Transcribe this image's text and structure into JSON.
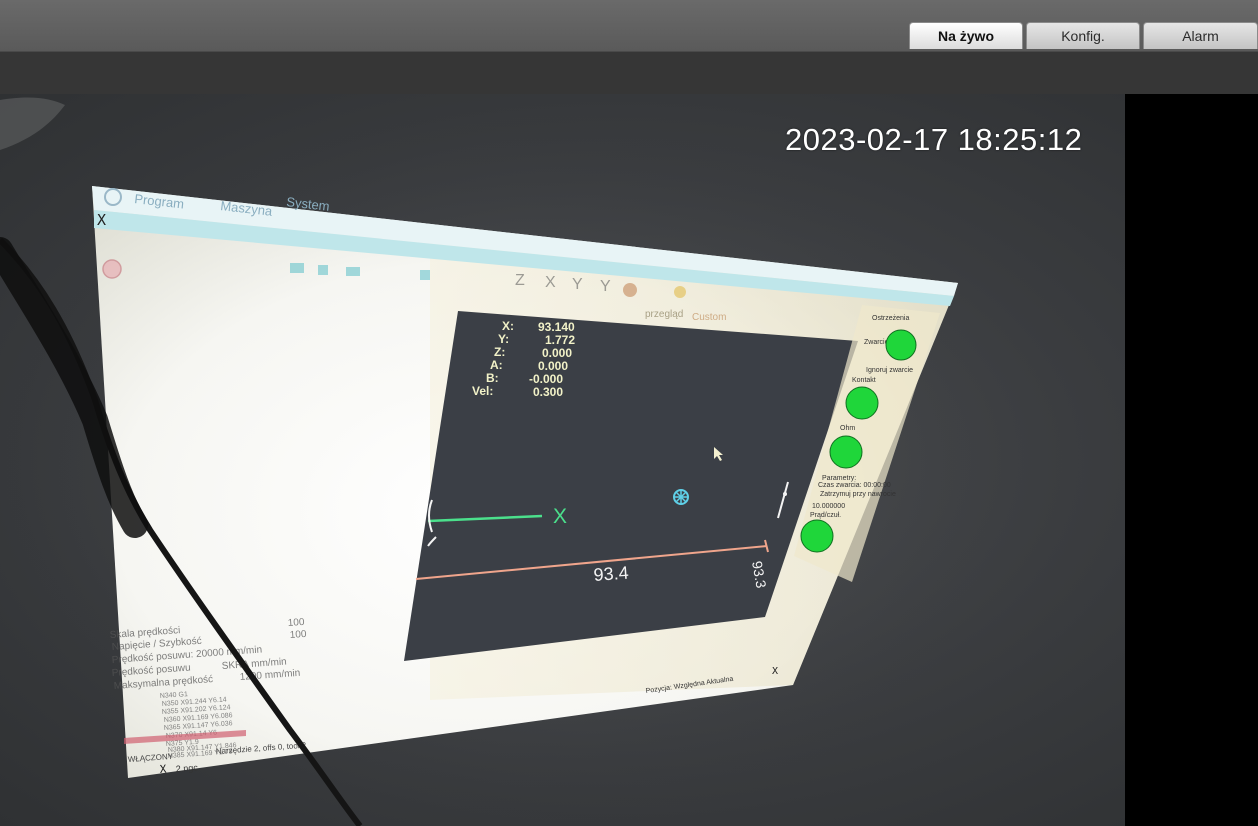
{
  "header": {
    "tabs": [
      {
        "label": "Na żywo",
        "active": true
      },
      {
        "label": "Konfig.",
        "active": false
      },
      {
        "label": "Alarm",
        "active": false
      }
    ]
  },
  "video": {
    "timestamp": "2023-02-17 18:25:12"
  },
  "monitor": {
    "menu": [
      "Program",
      "Maszyna",
      "System"
    ],
    "x_glyph": "X",
    "dro": [
      {
        "axis": "X:",
        "value": "93.140"
      },
      {
        "axis": "Y:",
        "value": "1.772"
      },
      {
        "axis": "Z:",
        "value": "0.000"
      },
      {
        "axis": "A:",
        "value": "0.000"
      },
      {
        "axis": "B:",
        "value": "-0.000"
      },
      {
        "axis": "Vel:",
        "value": "0.300"
      }
    ],
    "dim_horizontal": "93.4",
    "dim_vertical": "93.3",
    "x_marker": "X",
    "view_tabs": [
      "przegląd",
      "Custom"
    ],
    "side_panel": {
      "group1": "Ostrzeżenia",
      "short_label": "Zwarcie",
      "ignore_short": "Ignoruj zwarcie",
      "contact_label": "Kontakt",
      "ohm_label": "Ohm",
      "params_label": "Parametry:",
      "time_label": "Czas zwarcia: 00:00:00",
      "stop_label": "Zatrzymuj przy nawrocie",
      "value_field": "10.000000",
      "current_label": "Prąd/czuł."
    },
    "left_params": [
      {
        "label": "Skala prędkości",
        "value": "100"
      },
      {
        "label": "Napięcie / Szybkość",
        "value": "100"
      },
      {
        "label": "Prędkość posuwu: 20000 mm/min",
        "value": ""
      },
      {
        "label": "Prędkość posuwu",
        "value": "SKRA mm/min"
      },
      {
        "label": "Maksymalna prędkość",
        "value": "1200 mm/min"
      }
    ],
    "gcode_lines": [
      "N340 G1",
      "N350 X91.244 Y6.14",
      "N355 X91.202 Y6.124",
      "N360 X91.169 Y6.086",
      "N365 X91.147 Y6.036",
      "N370 X91.14 Y6",
      "N375 Y1.9",
      "N380 X91.147 Y1.846",
      "N385 X91.169 Y1.79"
    ],
    "status_on": "WŁĄCZONY",
    "tool_line": "Narzędzie 2, offs 0, tool 2",
    "file_name": "2.ngc",
    "position_label": "Pozycja: Względna Aktualna",
    "corner_x": "X"
  },
  "colors": {
    "led_green": "#1fd63a",
    "dro_yellow": "#f2f2c8",
    "tool_path_green": "#4be08c",
    "dim_line": "#f0a58c",
    "preview_bg": "#3b3f46"
  }
}
